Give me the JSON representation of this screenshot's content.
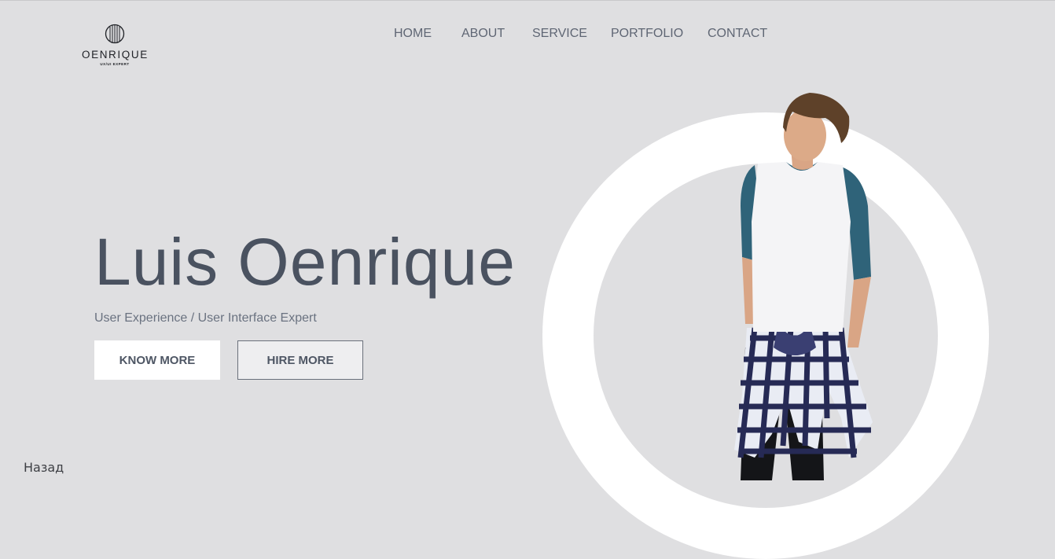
{
  "logo": {
    "name": "OENRIQUE",
    "tagline": "UX/UI EXPERT"
  },
  "nav": {
    "items": [
      {
        "label": "HOME"
      },
      {
        "label": "ABOUT"
      },
      {
        "label": "SERVICE"
      },
      {
        "label": "PORTFOLIO"
      },
      {
        "label": "CONTACT"
      }
    ]
  },
  "hero": {
    "title": "Luis Oenrique",
    "subtitle": "User Experience / User Interface Expert",
    "primary_button": "KNOW MORE",
    "secondary_button": "HIRE MORE"
  },
  "footer": {
    "back_label": "Назад"
  },
  "colors": {
    "background": "#dfdfe1",
    "heading": "#4a5260",
    "nav_text": "#5f6674",
    "ring": "#ffffff",
    "shirt_sleeves": "#2f6379"
  },
  "icons": {
    "logo_mark": "striped-circle-logo-icon"
  }
}
